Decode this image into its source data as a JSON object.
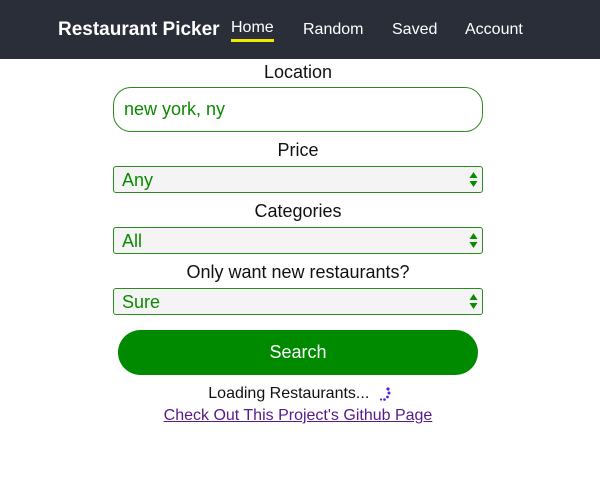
{
  "app": {
    "brand": "Restaurant Picker"
  },
  "nav": {
    "items": [
      {
        "label": "Home",
        "active": true
      },
      {
        "label": "Random",
        "active": false
      },
      {
        "label": "Saved",
        "active": false
      },
      {
        "label": "Account",
        "active": false
      }
    ]
  },
  "form": {
    "location": {
      "label": "Location",
      "value": "new york, ny"
    },
    "price": {
      "label": "Price",
      "selected": "Any"
    },
    "categories": {
      "label": "Categories",
      "selected": "All"
    },
    "new_only": {
      "label": "Only want new restaurants?",
      "selected": "Sure"
    },
    "search_button": "Search"
  },
  "status": {
    "loading_text": "Loading Restaurants..."
  },
  "footer": {
    "github_link": "Check Out This Project's Github Page"
  },
  "colors": {
    "navbar_bg": "#292e38",
    "active_underline": "#f2e800",
    "accent_green": "#008a00",
    "field_text": "#0a8a00",
    "spinner": "#5a1fd6",
    "link_visited": "#551a8b"
  },
  "icons": {
    "select_arrows": "up-down-arrows-icon",
    "spinner": "loading-spinner-icon"
  }
}
